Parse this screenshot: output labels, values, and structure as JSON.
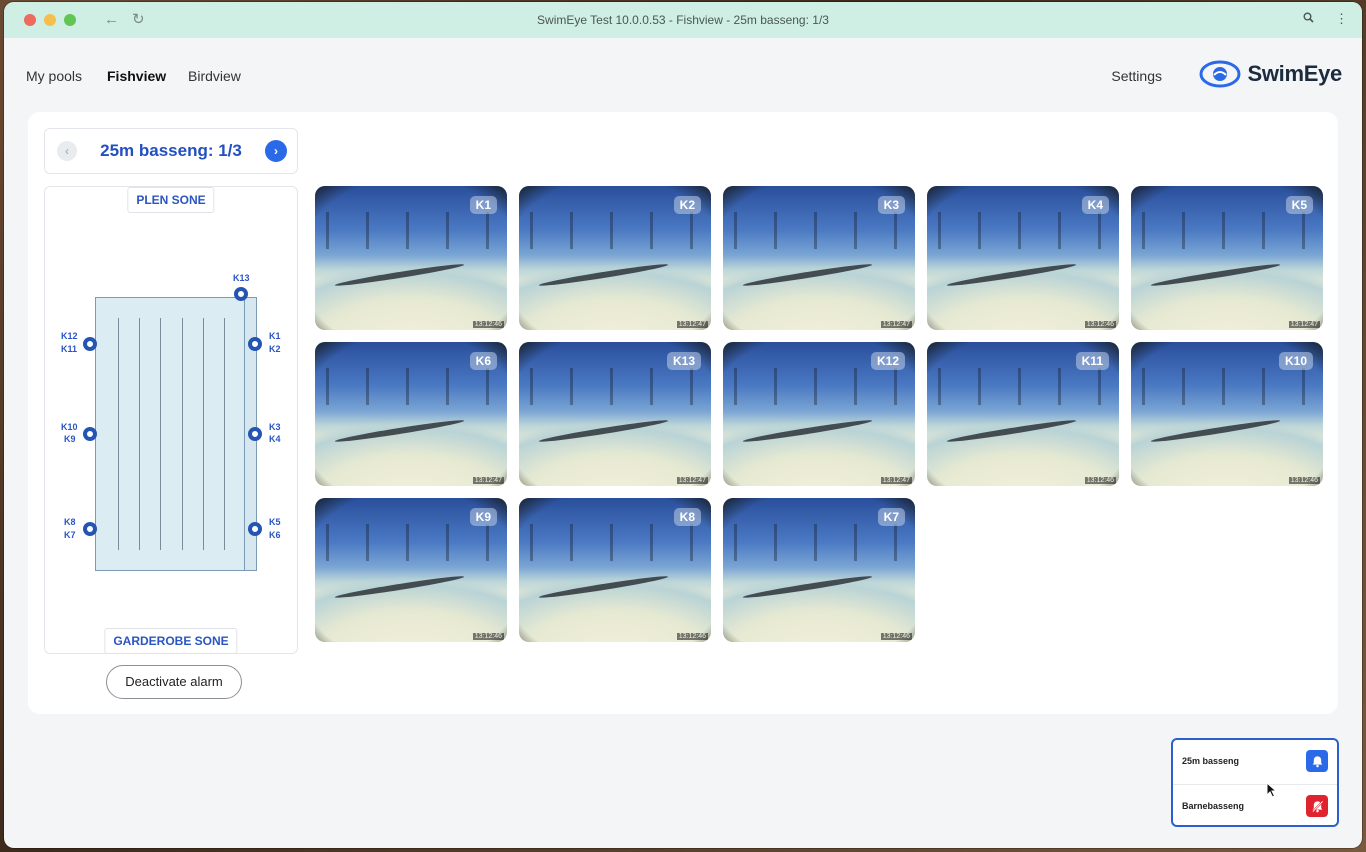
{
  "window": {
    "title": "SwimEye Test 10.0.0.53 - Fishview - 25m basseng: 1/3"
  },
  "nav": {
    "links": [
      "My pools",
      "Fishview",
      "Birdview"
    ],
    "active": "Fishview",
    "settings": "Settings",
    "brand": "SwimEye"
  },
  "pager": {
    "title": "25m basseng: 1/3"
  },
  "map": {
    "top_zone": "PLEN SONE",
    "bottom_zone": "GARDEROBE SONE",
    "camera_labels": {
      "top": "K13",
      "left_1": [
        "K12",
        "K11"
      ],
      "left_2": [
        "K10",
        "K9"
      ],
      "left_3": [
        "K8",
        "K7"
      ],
      "right_1": [
        "K1",
        "K2"
      ],
      "right_2": [
        "K3",
        "K4"
      ],
      "right_3": [
        "K5",
        "K6"
      ]
    }
  },
  "deactivate_button": "Deactivate alarm",
  "cameras": [
    {
      "label": "K1",
      "time": "13:12:46"
    },
    {
      "label": "K2",
      "time": "13:12:47"
    },
    {
      "label": "K3",
      "time": "13:12:47"
    },
    {
      "label": "K4",
      "time": "13:12:46"
    },
    {
      "label": "K5",
      "time": "13:12:47"
    },
    {
      "label": "K6",
      "time": "13:12:47"
    },
    {
      "label": "K13",
      "time": "13:12:47"
    },
    {
      "label": "K12",
      "time": "13:12:47"
    },
    {
      "label": "K11",
      "time": "13:12:46"
    },
    {
      "label": "K10",
      "time": "13:12:46"
    },
    {
      "label": "K9",
      "time": "13:12:46"
    },
    {
      "label": "K8",
      "time": "13:12:46"
    },
    {
      "label": "K7",
      "time": "13:12:46"
    }
  ],
  "pool_status": [
    {
      "name": "25m basseng",
      "icon": "bell-icon",
      "state": "alarm-active",
      "color": "#2a6ae8"
    },
    {
      "name": "Barnebasseng",
      "icon": "bell-off-icon",
      "state": "alarm-off",
      "color": "#e0242f"
    }
  ],
  "colors": {
    "accent": "#2350c0",
    "titlebar": "#cfeee4"
  }
}
